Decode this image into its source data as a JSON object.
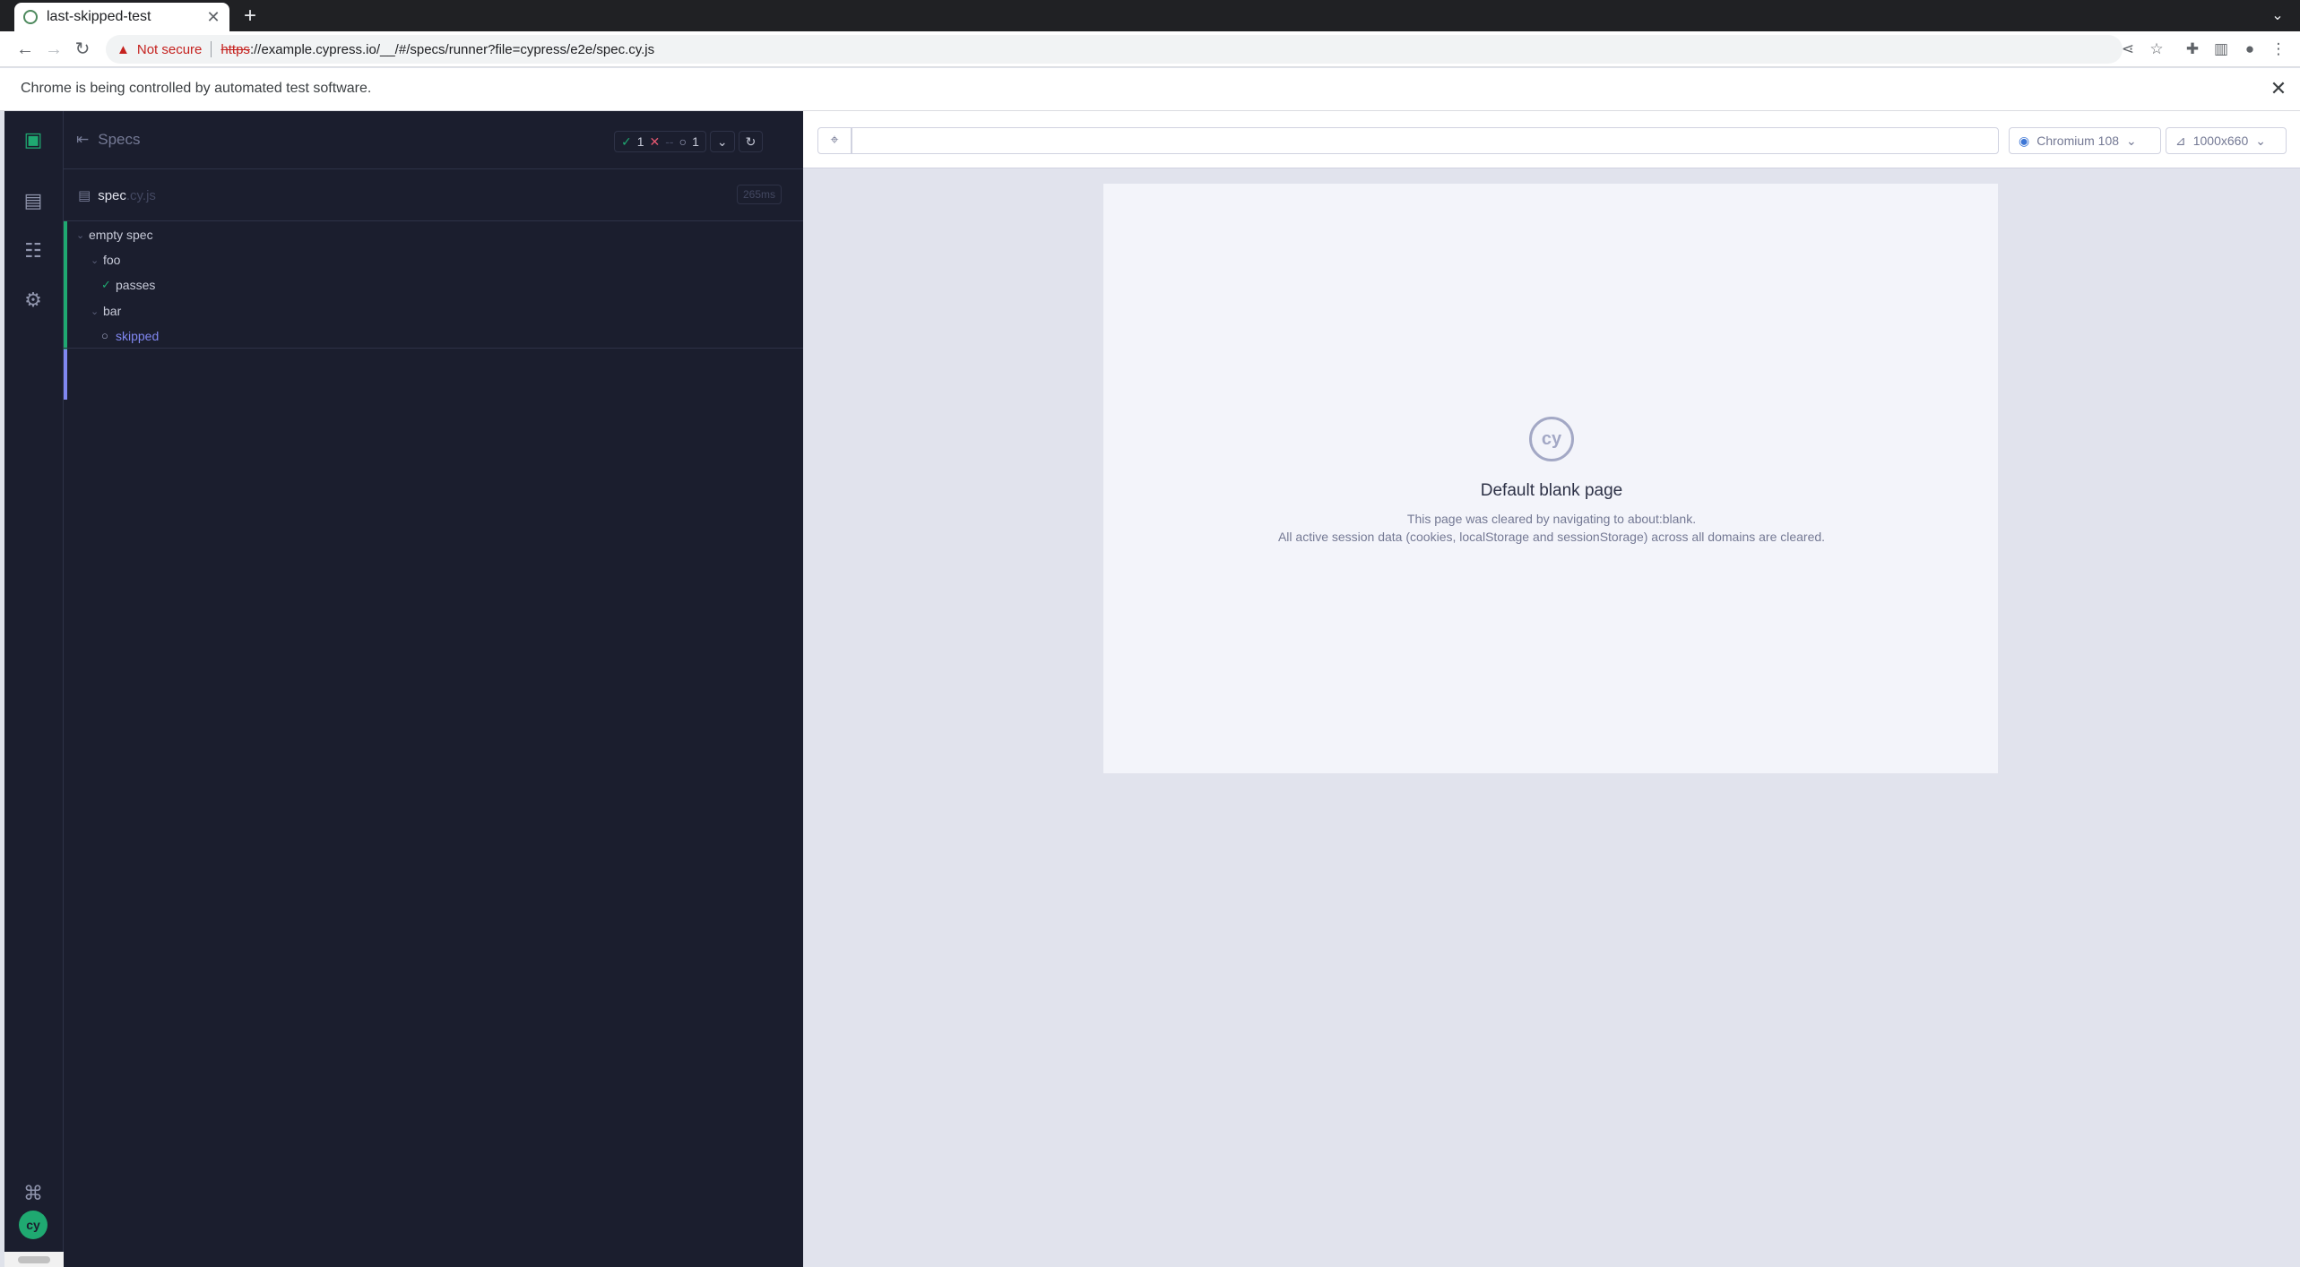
{
  "browser": {
    "tab_title": "last-skipped-test",
    "new_tab_glyph": "+",
    "address": {
      "security_label": "Not secure",
      "scheme": "https",
      "url_rest": "://example.cypress.io/__/#/specs/runner?file=cypress/e2e/spec.cy.js"
    },
    "infobar": "Chrome is being controlled by automated test software."
  },
  "reporter": {
    "specs_label": "Specs",
    "stats": {
      "passed": "1",
      "failed": "--",
      "pending": "1"
    },
    "spec": {
      "name": "spec",
      "ext": ".cy.js",
      "duration": "265ms"
    },
    "tests": [
      {
        "label": "empty spec",
        "kind": "suite"
      },
      {
        "label": "foo",
        "kind": "suite"
      },
      {
        "label": "passes",
        "kind": "passed"
      },
      {
        "label": "bar",
        "kind": "suite"
      },
      {
        "label": "skipped",
        "kind": "pending"
      }
    ]
  },
  "aut": {
    "browser": "Chromium 108",
    "viewport": "1000x660",
    "blank": {
      "logo_text": "cy",
      "title": "Default blank page",
      "line1": "This page was cleared by navigating to about:blank.",
      "line2": "All active session data (cookies, localStorage and sessionStorage) across all domains are cleared."
    }
  },
  "nav": {
    "logo_text": "cy"
  },
  "colors": {
    "passed": "#1fa971",
    "failed": "#e45770",
    "pending": "#8087f0",
    "reporter_bg": "#1b1e2e"
  }
}
